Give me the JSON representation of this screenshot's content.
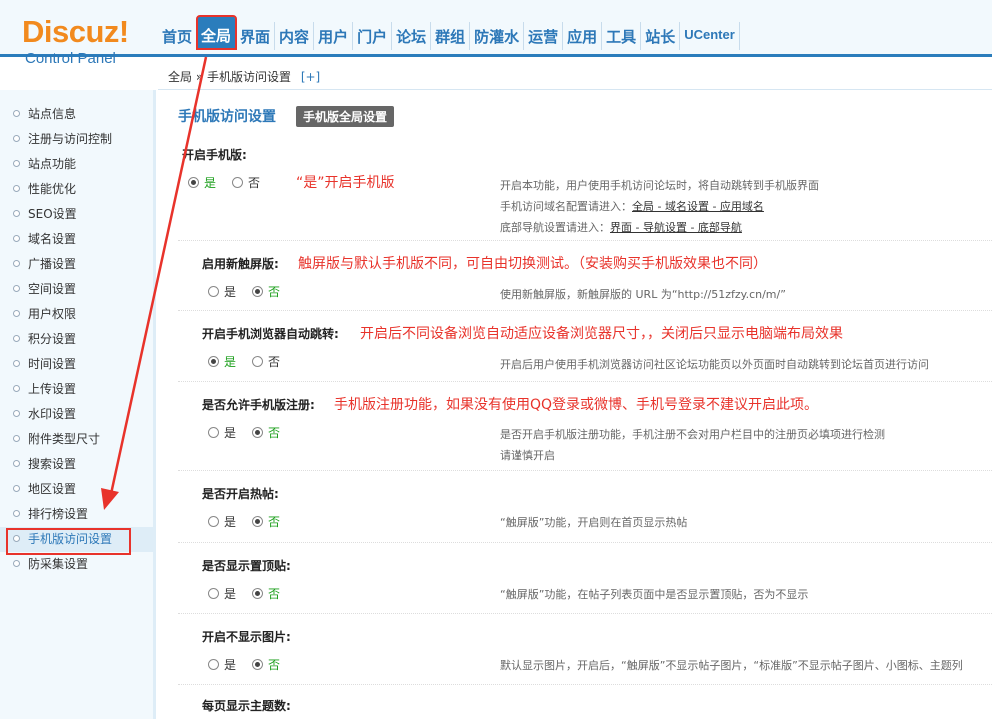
{
  "logo": {
    "word": "Discuz!",
    "sub": "Control Panel"
  },
  "nav": [
    "首页",
    "全局",
    "界面",
    "内容",
    "用户",
    "门户",
    "论坛",
    "群组",
    "防灌水",
    "运营",
    "应用",
    "工具",
    "站长",
    "UCenter"
  ],
  "breadcrumb": {
    "path": "全局 » 手机版访问设置",
    "add": "[+]"
  },
  "sidebar": [
    "站点信息",
    "注册与访问控制",
    "站点功能",
    "性能优化",
    "SEO设置",
    "域名设置",
    "广播设置",
    "空间设置",
    "用户权限",
    "积分设置",
    "时间设置",
    "上传设置",
    "水印设置",
    "附件类型尺寸",
    "搜索设置",
    "地区设置",
    "排行榜设置",
    "手机版访问设置",
    "防采集设置"
  ],
  "main": {
    "title": "手机版访问设置",
    "tab": "手机版全局设置",
    "yes": "是",
    "no": "否",
    "settings": [
      {
        "label": "开启手机版:",
        "annot": "“是”开启手机版",
        "selected": "yes",
        "desc": [
          "开启本功能，用户使用手机访问论坛时，将自动跳转到手机版界面"
        ],
        "desc_link1_prefix": "手机访问域名配置请进入：",
        "desc_link1": "全局 - 域名设置 - 应用域名",
        "desc_link2_prefix": "底部导航设置请进入：",
        "desc_link2": "界面 - 导航设置 - 底部导航"
      },
      {
        "label": "启用新触屏版:",
        "annot": "触屏版与默认手机版不同，可自由切换测试。（安装购买手机版效果也不同）",
        "selected": "no",
        "desc": [
          "使用新触屏版，新触屏版的 URL 为“http://51zfzy.cn/m/”"
        ]
      },
      {
        "label": "开启手机浏览器自动跳转:",
        "annot": "开启后不同设备浏览自动适应设备浏览器尺寸，，关闭后只显示电脑端布局效果",
        "selected": "yes",
        "desc": [
          "开启后用户使用手机浏览器访问社区论坛功能页以外页面时自动跳转到论坛首页进行访问"
        ]
      },
      {
        "label": "是否允许手机版注册:",
        "annot": "手机版注册功能，如果没有使用QQ登录或微博、手机号登录不建议开启此项。",
        "selected": "no",
        "desc": [
          "是否开启手机版注册功能，手机注册不会对用户栏目中的注册页必填项进行检测",
          "请谨慎开启"
        ]
      },
      {
        "label": "是否开启热帖:",
        "annot": "",
        "selected": "no",
        "desc": [
          "“触屏版”功能，开启则在首页显示热帖"
        ]
      },
      {
        "label": "是否显示置顶贴:",
        "annot": "",
        "selected": "no",
        "desc": [
          "“触屏版”功能，在帖子列表页面中是否显示置顶贴，否为不显示"
        ]
      },
      {
        "label": "开启不显示图片:",
        "annot": "",
        "selected": "no",
        "desc": [
          "默认显示图片，开启后，“触屏版”不显示帖子图片，“标准版”不显示帖子图片、小图标、主题列"
        ]
      },
      {
        "label": "每页显示主题数:",
        "annot": "",
        "selected": "",
        "desc": []
      }
    ]
  },
  "colors": {
    "accent": "#2b7dbc",
    "annotation": "#e8332b",
    "logo": "#f28a1e"
  }
}
